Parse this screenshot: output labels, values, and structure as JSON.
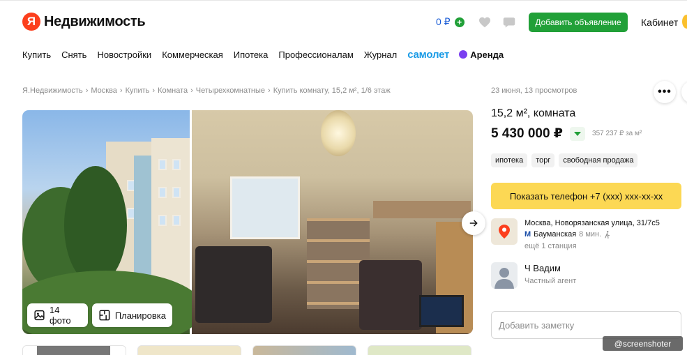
{
  "header": {
    "logo_letter": "Я",
    "logo_text": "Недвижимость",
    "wallet": "0 ₽",
    "wallet_plus": "+",
    "add_button": "Добавить объявление",
    "cabinet": "Кабинет"
  },
  "nav": {
    "items": [
      "Купить",
      "Снять",
      "Новостройки",
      "Коммерческая",
      "Ипотека",
      "Профессионалам",
      "Журнал"
    ],
    "samolet": "самолет",
    "arenda": "Аренда"
  },
  "breadcrumb": [
    "Я.Недвижимость",
    "Москва",
    "Купить",
    "Комната",
    "Четырехкомнатные",
    "Купить комнату, 15,2 м², 1/6 этаж"
  ],
  "gallery": {
    "photos_button": "14 фото",
    "plan_button": "Планировка"
  },
  "listing": {
    "meta": "23 июня, 13 просмотров",
    "more": "•••",
    "title": "15,2 м², комната",
    "price": "5 430 000 ₽",
    "price_per_m2": "357 237 ₽ за м²",
    "tags": [
      "ипотека",
      "торг",
      "свободная продажа"
    ],
    "phone_button": "Показать телефон +7 (ххх) ххх-хх-хх",
    "address": "Москва, Новорязанская улица, 31/7с5",
    "metro_letter": "М",
    "metro_station": "Бауманская",
    "metro_time": "8 мин.",
    "more_stations": "ещё 1 станция",
    "agent_name": "Ч Вадим",
    "agent_role": "Частный агент",
    "note_placeholder": "Добавить заметку"
  },
  "watermark": "@screenshoter",
  "colors": {
    "brand_red": "#fc3f1d",
    "green": "#21a038",
    "yellow": "#fcd854",
    "link_blue": "#1a5cd6"
  }
}
